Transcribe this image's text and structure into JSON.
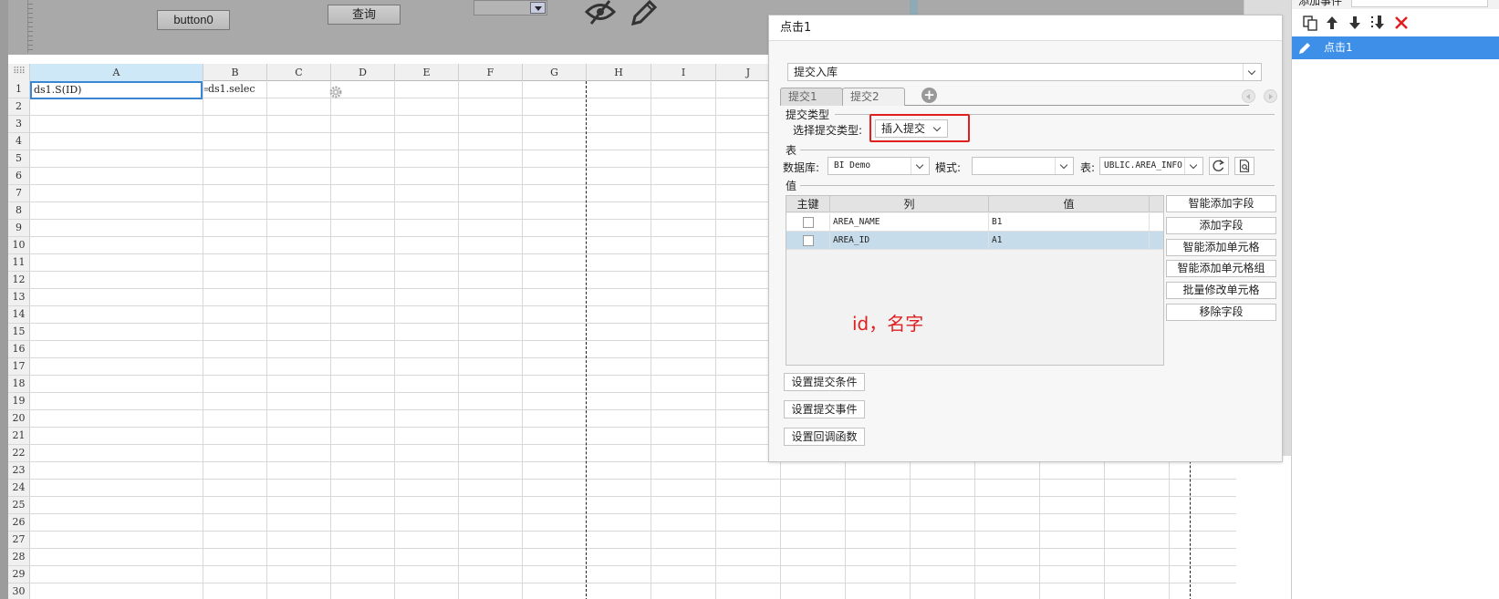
{
  "form": {
    "button0_label": "button0",
    "query_label": "查询"
  },
  "sheet": {
    "columns": [
      "A",
      "B",
      "C",
      "D",
      "E",
      "F",
      "G",
      "H",
      "I",
      "J"
    ],
    "rows": [
      "1",
      "2",
      "3",
      "4",
      "5",
      "6",
      "7",
      "8",
      "9",
      "10",
      "11",
      "12",
      "13",
      "14",
      "15",
      "16",
      "17",
      "18",
      "19",
      "20",
      "21",
      "22",
      "23",
      "24",
      "25",
      "26",
      "27",
      "28",
      "29",
      "30"
    ],
    "cell_A1": "ds1.S(ID)",
    "cell_B1": "ds1.selec"
  },
  "dialog": {
    "title": "点击1",
    "action_type": "提交入库",
    "tabs": [
      "提交1",
      "提交2"
    ],
    "submit_type_section": "提交类型",
    "submit_type_label": "选择提交类型:",
    "submit_type_value": "插入提交",
    "table_section": "表",
    "database_label": "数据库:",
    "database_value": "BI Demo",
    "schema_label": "模式:",
    "schema_value": "",
    "table_label": "表:",
    "table_value": "UBLIC.AREA_INFO",
    "value_section": "值",
    "value_table": {
      "headers": [
        "主键",
        "列",
        "值"
      ],
      "rows": [
        {
          "key": false,
          "column": "AREA_NAME",
          "value": "B1"
        },
        {
          "key": false,
          "column": "AREA_ID",
          "value": "A1"
        }
      ]
    },
    "side_buttons": [
      "智能添加字段",
      "添加字段",
      "智能添加单元格",
      "智能添加单元格组",
      "批量修改单元格",
      "移除字段"
    ],
    "annotation": "id，名字",
    "config_buttons": [
      "设置提交条件",
      "设置提交事件",
      "设置回调函数"
    ]
  },
  "event_panel": {
    "header_label": "添加事件",
    "event_item": "点击1",
    "accent_color": "#3d8fe8"
  }
}
